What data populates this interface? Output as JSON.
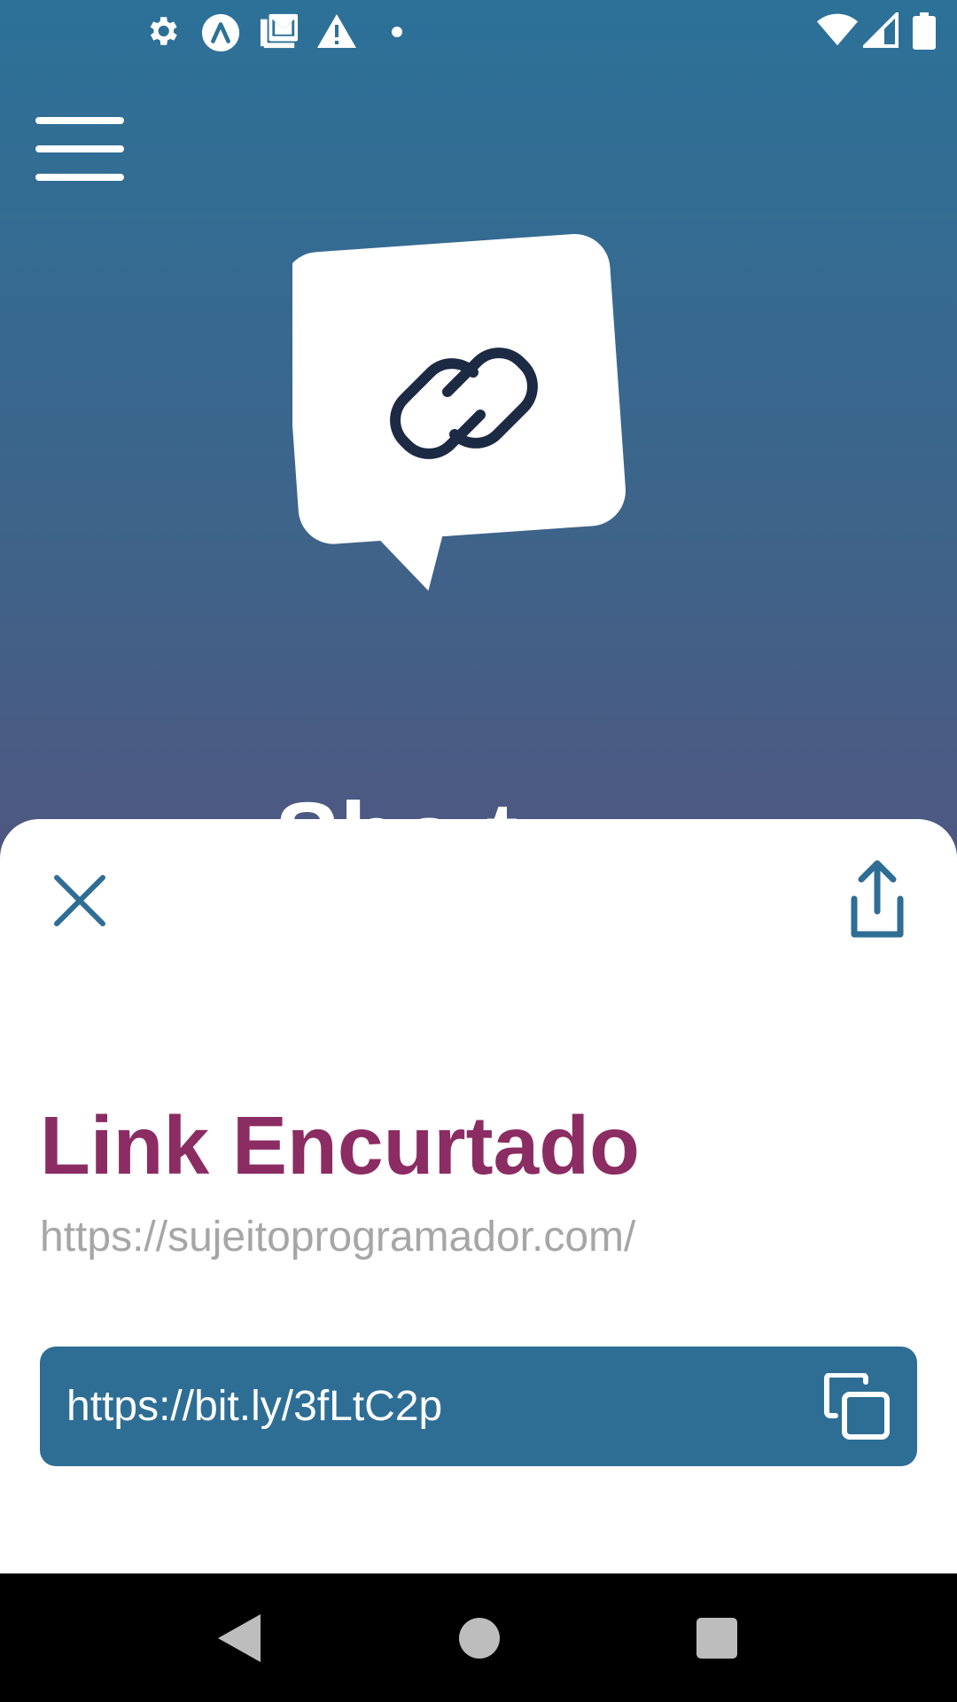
{
  "status_bar": {
    "left_icons": [
      "gear-icon",
      "a-circle-icon",
      "gallery-mail-icon",
      "warning-icon",
      "dot-icon"
    ],
    "right_icons": [
      "wifi-icon",
      "signal-icon",
      "battery-icon"
    ]
  },
  "header": {
    "menu_icon": "hamburger-menu-icon",
    "logo_icon": "chain-link-speech-bubble-icon",
    "title_peek": "Sho t"
  },
  "sheet": {
    "close_icon": "close-icon",
    "share_icon": "share-icon",
    "title": "Link Encurtado",
    "original_url": "https://sujeitoprogramador.com/",
    "short_url": "https://bit.ly/3fLtC2p",
    "copy_icon": "copy-icon"
  },
  "nav_bar": {
    "back_icon": "back-triangle-icon",
    "home_icon": "home-circle-icon",
    "recents_icon": "recents-square-icon"
  },
  "colors": {
    "gradient_top": "#2c7198",
    "gradient_bottom": "#5c4a78",
    "title": "#8b2c63",
    "accent": "#2e6e95",
    "url_gray": "#a6a6a6"
  }
}
